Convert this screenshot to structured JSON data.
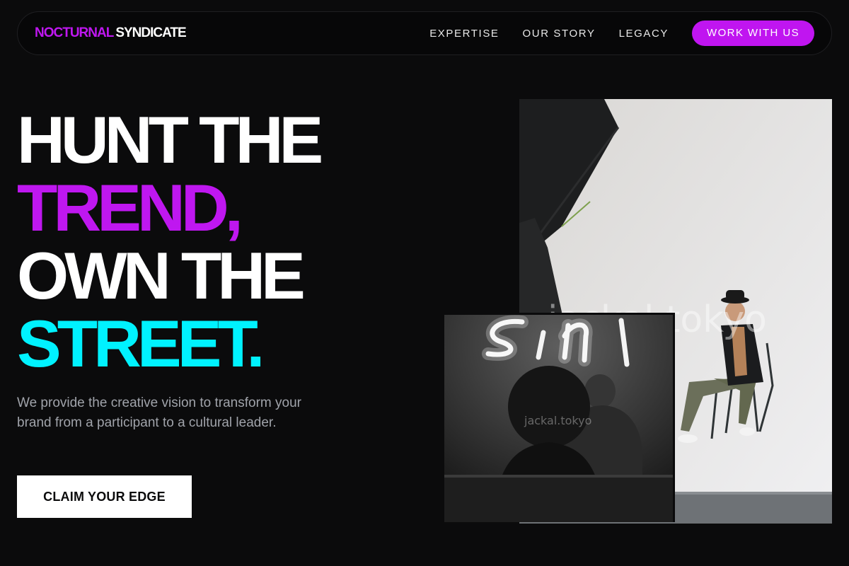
{
  "brand": {
    "part1": "NOCTURNAL",
    "part2": "SYNDICATE"
  },
  "nav": {
    "links": [
      {
        "label": "EXPERTISE"
      },
      {
        "label": "OUR STORY"
      },
      {
        "label": "LEGACY"
      }
    ],
    "cta_label": "WORK WITH US"
  },
  "hero": {
    "headline": {
      "line1": "HUNT THE",
      "line2": "TREND,",
      "line3": "OWN THE",
      "line4": "STREET."
    },
    "subtext": "We provide the creative vision to transform your brand from a participant to a cultural leader.",
    "cta_label": "CLAIM YOUR EDGE"
  },
  "images": {
    "studio_watermark": "jackal.tokyo",
    "neon_watermark": "jackal.tokyo"
  },
  "colors": {
    "background": "#0b0b0c",
    "accent_purple": "#bf17f0",
    "accent_cyan": "#00f2ff",
    "text_muted": "#a0a3aa"
  }
}
